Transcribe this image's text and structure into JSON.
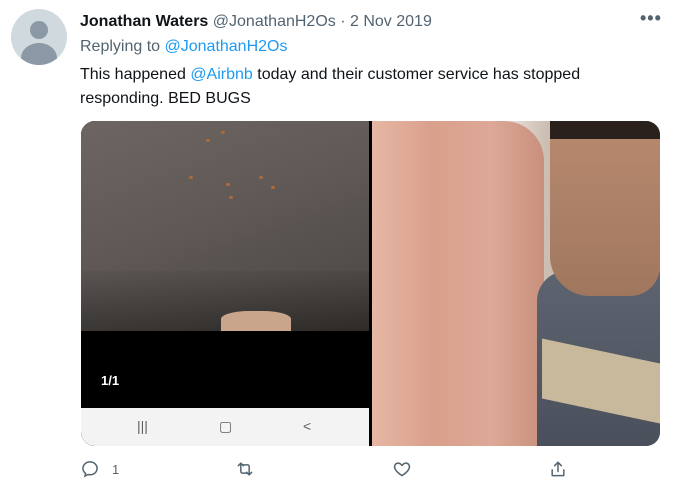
{
  "tweet": {
    "author_name": "Jonathan Waters",
    "author_handle": "@JonathanH2Os",
    "separator": "·",
    "date": "2 Nov 2019",
    "more_label": "•••",
    "reply_prefix": "Replying to",
    "reply_handle": "@JonathanH2Os",
    "text_before_mention": "This happened ",
    "mention": "@Airbnb",
    "text_after_mention": " today and their customer service has stopped responding. BED BUGS"
  },
  "media": {
    "left_counter": "1/1",
    "nav_icons": [
      "|||",
      "▢",
      "<"
    ]
  },
  "actions": {
    "reply_count": "1",
    "retweet_count": "",
    "like_count": "",
    "icons": [
      "reply-icon",
      "retweet-icon",
      "like-icon",
      "share-icon"
    ]
  },
  "colors": {
    "link": "#1d9bf0",
    "muted": "#536471",
    "text": "#0f1419"
  }
}
